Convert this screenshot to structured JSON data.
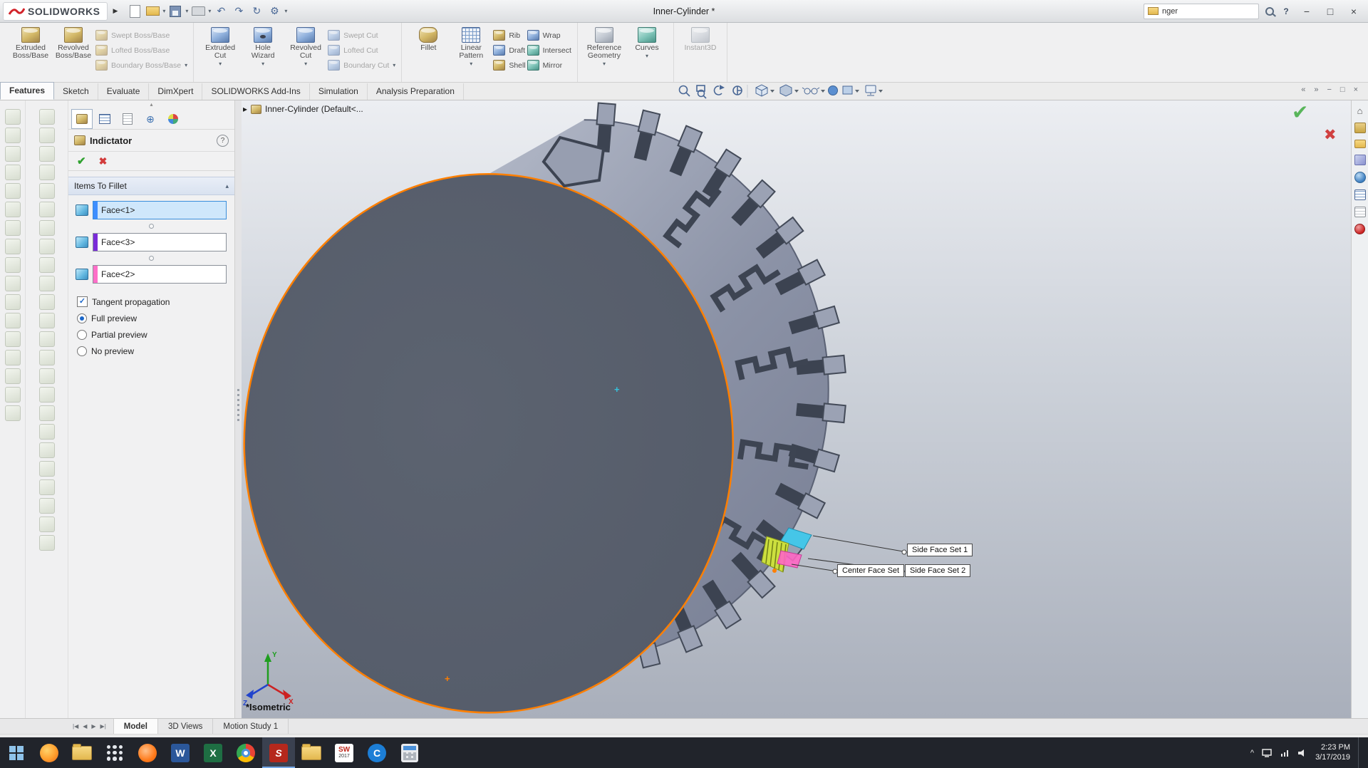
{
  "titlebar": {
    "logo": "SOLIDWORKS",
    "title": "Inner-Cylinder *",
    "search_value": "nger",
    "help_label": "?",
    "quick_icons": [
      "new-document",
      "open",
      "save",
      "print",
      "undo",
      "redo",
      "rebuild",
      "options"
    ]
  },
  "ribbon": {
    "groups": [
      {
        "big": [
          {
            "l1": "Extruded",
            "l2": "Boss/Base"
          },
          {
            "l1": "Revolved",
            "l2": "Boss/Base"
          }
        ],
        "small": [
          {
            "label": "Swept Boss/Base"
          },
          {
            "label": "Lofted Boss/Base"
          },
          {
            "label": "Boundary Boss/Base"
          }
        ]
      },
      {
        "big": [
          {
            "l1": "Extruded",
            "l2": "Cut"
          },
          {
            "l1": "Hole",
            "l2": "Wizard"
          },
          {
            "l1": "Revolved",
            "l2": "Cut"
          }
        ],
        "small": [
          {
            "label": "Swept Cut"
          },
          {
            "label": "Lofted Cut"
          },
          {
            "label": "Boundary Cut"
          }
        ]
      },
      {
        "big": [
          {
            "l1": "Fillet",
            "l2": ""
          },
          {
            "l1": "Linear",
            "l2": "Pattern"
          }
        ],
        "small": [
          {
            "label": "Rib"
          },
          {
            "label": "Draft"
          },
          {
            "label": "Shell"
          }
        ],
        "small2": [
          {
            "label": "Wrap"
          },
          {
            "label": "Intersect"
          },
          {
            "label": "Mirror"
          }
        ]
      },
      {
        "big": [
          {
            "l1": "Reference",
            "l2": "Geometry"
          },
          {
            "l1": "Curves",
            "l2": ""
          }
        ]
      },
      {
        "big": [
          {
            "l1": "Instant3D",
            "l2": ""
          }
        ]
      }
    ]
  },
  "command_tabs": {
    "items": [
      {
        "label": "Features"
      },
      {
        "label": "Sketch"
      },
      {
        "label": "Evaluate"
      },
      {
        "label": "DimXpert"
      },
      {
        "label": "SOLIDWORKS Add-Ins"
      },
      {
        "label": "Simulation"
      },
      {
        "label": "Analysis Preparation"
      }
    ]
  },
  "headsup_icons": [
    "zoom-fit",
    "zoom-area",
    "previous-view",
    "section-view",
    "view-orientation",
    "display-style",
    "hide-show-items",
    "edit-appearance",
    "apply-scene",
    "view-settings"
  ],
  "property_manager": {
    "title": "Indictator",
    "section_title": "Items To Fillet",
    "faces": [
      {
        "label": "Face<1>",
        "swatch": "#3d8eff",
        "selected": true
      },
      {
        "label": "Face<3>",
        "swatch": "#7a2bd8",
        "selected": false
      },
      {
        "label": "Face<2>",
        "swatch": "#ff6fc8",
        "selected": false
      }
    ],
    "tangent_label": "Tangent propagation",
    "tangent_checked": true,
    "previews": [
      {
        "label": "Full preview",
        "selected": true
      },
      {
        "label": "Partial preview",
        "selected": false
      },
      {
        "label": "No preview",
        "selected": false
      }
    ]
  },
  "viewport": {
    "tree_label": "Inner-Cylinder  (Default<...",
    "view_label": "*Isometric",
    "callouts": [
      {
        "label": "Side Face Set 1"
      },
      {
        "label": "Center Face Set"
      },
      {
        "label": "Side Face Set 2"
      }
    ],
    "triad": {
      "x": "X",
      "y": "Y",
      "z": "Z"
    },
    "accent_colors": {
      "edge_highlight": "#ff7f00",
      "selected_face": "#45c6e8",
      "preview_face": "#ccdf3e",
      "mate_face": "#ff66c4"
    }
  },
  "right_pane_icons": [
    "home-icon",
    "design-library-icon",
    "file-explorer-icon",
    "view-palette-icon",
    "appearances-icon",
    "scenes-icon",
    "custom-properties-icon",
    "forum-icon"
  ],
  "bottom_tabs": {
    "items": [
      {
        "label": "Model"
      },
      {
        "label": "3D Views"
      },
      {
        "label": "Motion Study 1"
      }
    ]
  },
  "taskbar": {
    "apps": [
      "start",
      "firefox",
      "file-explorer",
      "app-grid",
      "browser",
      "word",
      "excel",
      "chrome",
      "solidworks",
      "folder",
      "solidworks-2017",
      "c-app",
      "calculator"
    ],
    "active_app": "solidworks",
    "tray": {
      "time": "2:23 PM",
      "date": "3/17/2019"
    }
  }
}
